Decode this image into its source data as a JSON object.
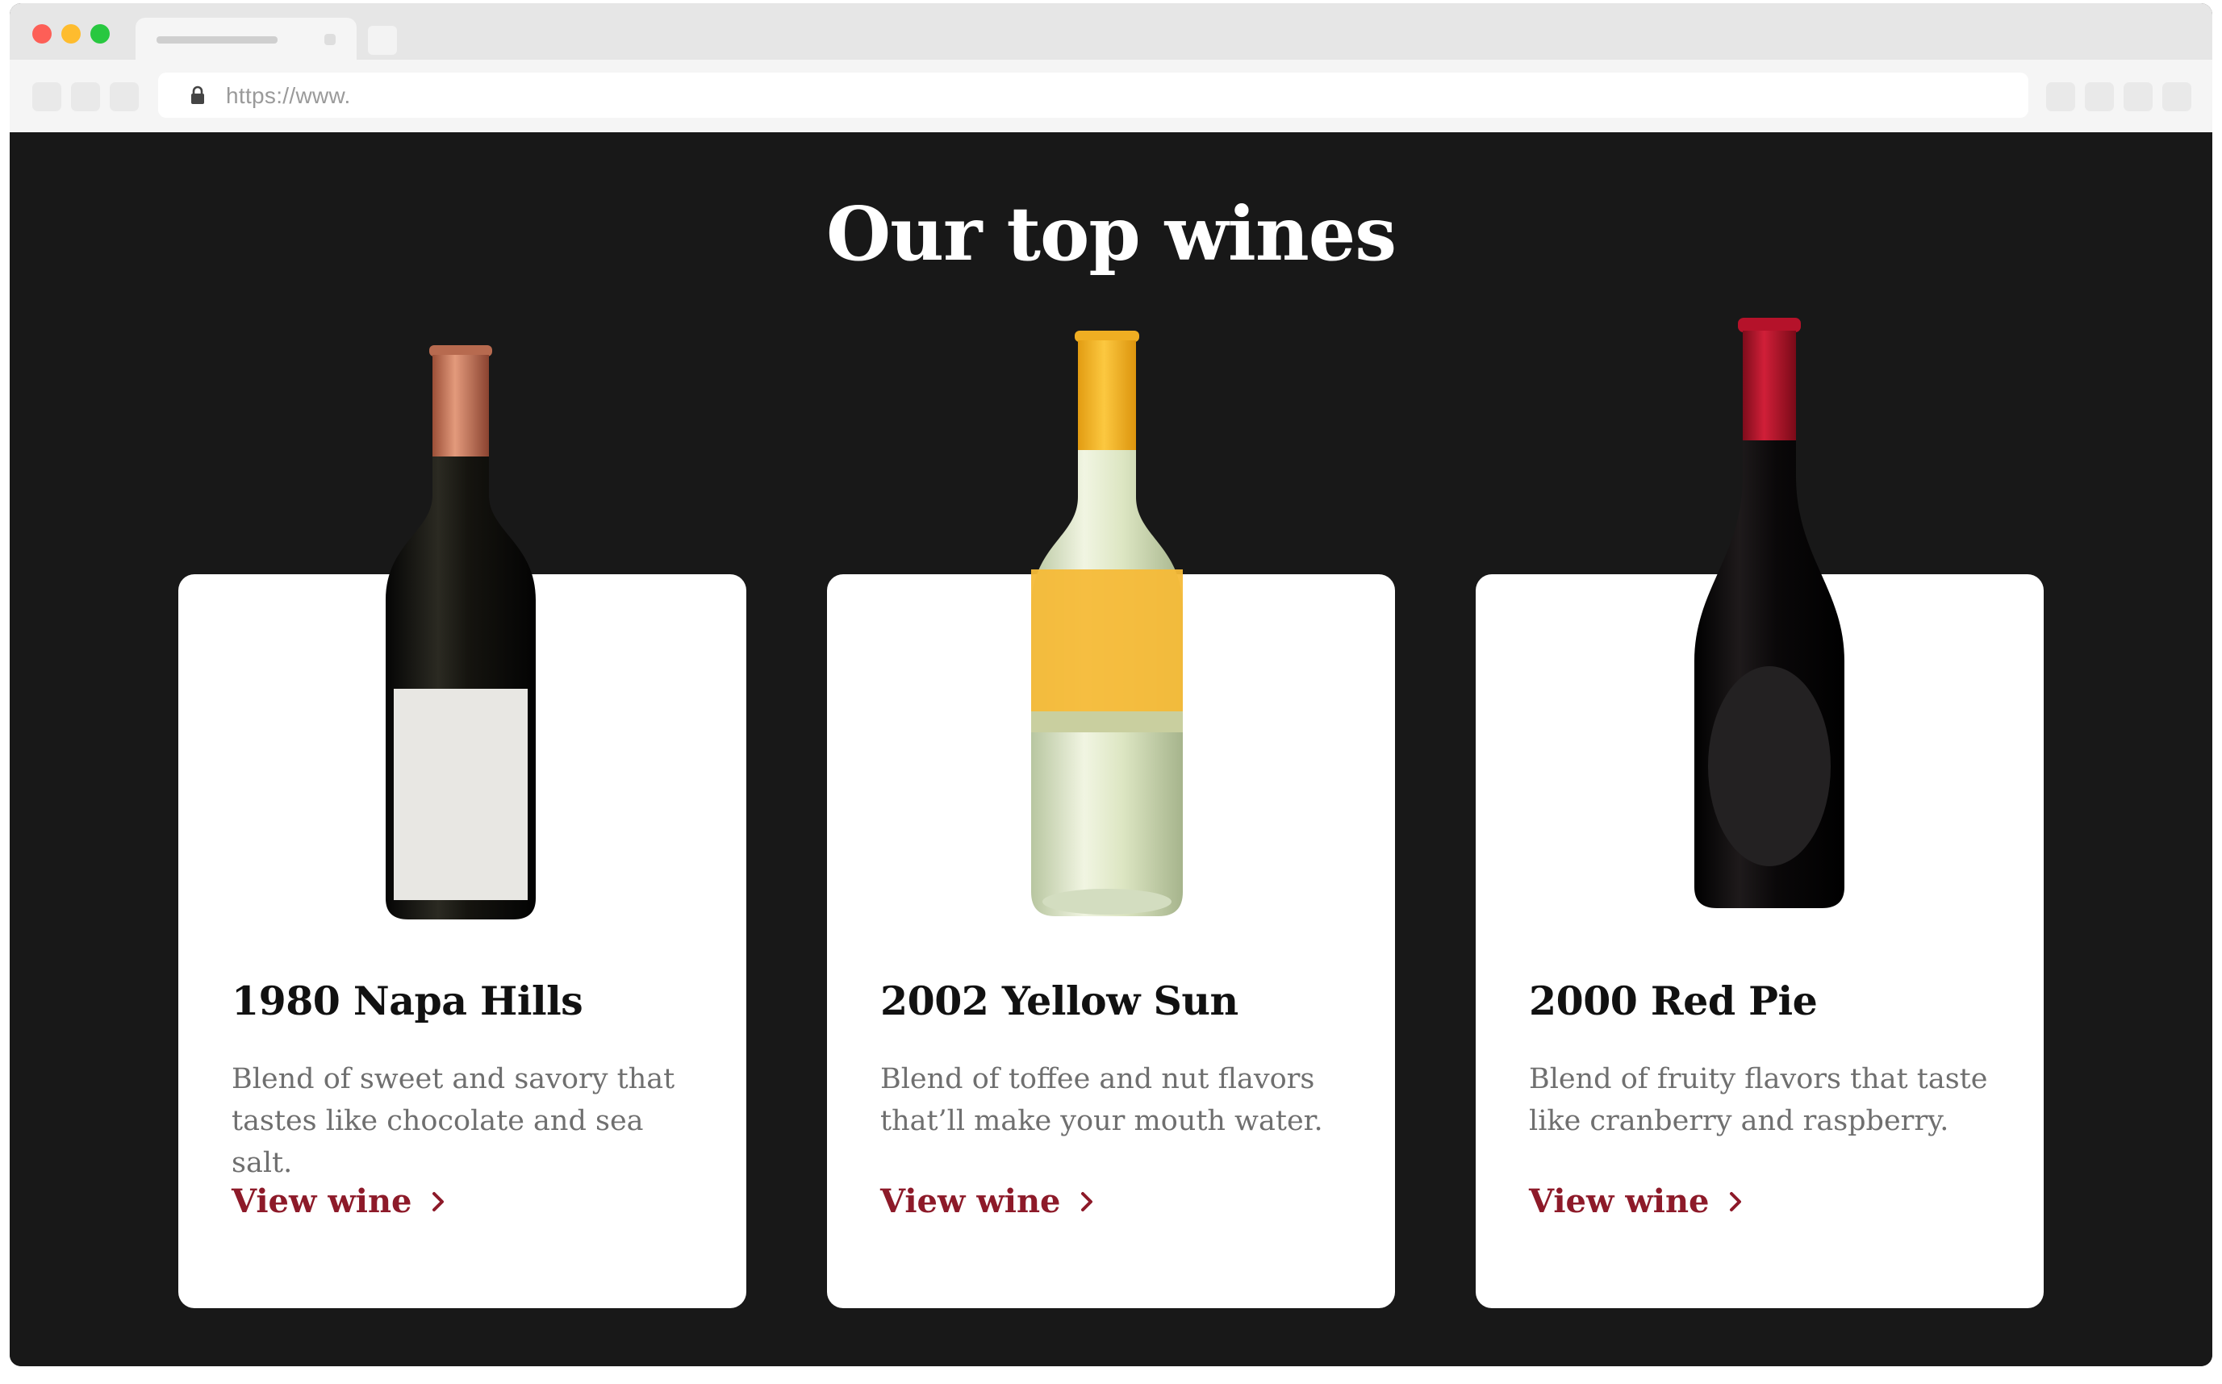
{
  "browser": {
    "url": "https://www."
  },
  "section": {
    "title": "Our top wines"
  },
  "wines": [
    {
      "name": "1980 Napa Hills",
      "description": "Blend of sweet and savory that tastes like chocolate and sea salt.",
      "link_label": "View wine",
      "capsule_color": "#c9775a",
      "glass_color": "#1c1a14",
      "label_color": "#ececea"
    },
    {
      "name": "2002 Yellow Sun",
      "description": "Blend of toffee and nut flavors that’ll make your mouth water.",
      "link_label": "View wine",
      "capsule_color": "#f6b62c",
      "glass_color": "#e3ebcf",
      "label_color": "#f7bd3c"
    },
    {
      "name": "2000 Red Pie",
      "description": "Blend of fruity flavors that taste like cranberry and raspberry.",
      "link_label": "View wine",
      "capsule_color": "#b5122a",
      "glass_color": "#0c0a0b",
      "label_color": "#222022"
    }
  ],
  "colors": {
    "background": "#181818",
    "card": "#ffffff",
    "accent": "#8d1a29",
    "title_text": "#ffffff",
    "body_text": "#6f6f6f"
  }
}
